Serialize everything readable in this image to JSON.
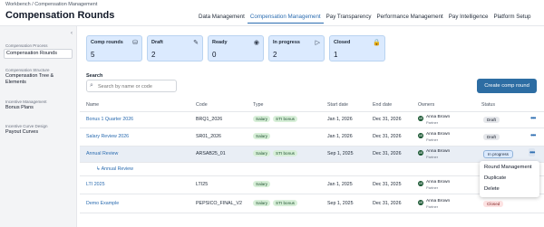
{
  "breadcrumb": "Workbench / Compensation Management",
  "page_title": "Compensation Rounds",
  "top_nav": [
    "Data Management",
    "Compensation Management",
    "Pay Transparency",
    "Performance Management",
    "Pay Intelligence",
    "Platform Setup"
  ],
  "top_nav_active": "Compensation Management",
  "sidebar": {
    "collapse_icon": "chevron-left-icon",
    "groups": [
      {
        "caption": "Compensation Process",
        "items": [
          "Compensation Rounds"
        ],
        "active": "Compensation Rounds"
      },
      {
        "caption": "Compensation Structure",
        "items": [
          "Compensation Tree &",
          "Elements"
        ]
      },
      {
        "caption": "Incentive Management",
        "items": [
          "Bonus Plans"
        ]
      },
      {
        "caption": "Incentive Curve Design",
        "items": [
          "Payout Curves"
        ]
      }
    ]
  },
  "summary_cards": [
    {
      "label": "Comp rounds",
      "value": "5",
      "icon": "coins-icon"
    },
    {
      "label": "Draft",
      "value": "2",
      "icon": "pencil-icon"
    },
    {
      "label": "Ready",
      "value": "0",
      "icon": "eye-icon"
    },
    {
      "label": "In progress",
      "value": "2",
      "icon": "play-icon"
    },
    {
      "label": "Closed",
      "value": "1",
      "icon": "lock-icon"
    }
  ],
  "search": {
    "label": "Search",
    "placeholder": "Search by name or code"
  },
  "create_button": "Create comp round",
  "table": {
    "columns": [
      "Name",
      "Code",
      "Type",
      "Start date",
      "End date",
      "Owners",
      "Status"
    ],
    "rows": [
      {
        "name": "Bonus 1 Quarter 2026",
        "code": "BRQ1_2026",
        "types": [
          "Salary",
          "STI bonus"
        ],
        "start": "Jan 1, 2026",
        "end": "Dec 31, 2026",
        "owner": "Anna Brown",
        "owner_role": "Partner",
        "status": "Draft"
      },
      {
        "name": "Salary Review 2026",
        "code": "SR01_2026",
        "types": [
          "Salary"
        ],
        "start": "Jan 1, 2026",
        "end": "Dec 31, 2026",
        "owner": "Anna Brown",
        "owner_role": "Partner",
        "status": "Draft"
      },
      {
        "name": "Annual Review",
        "code": "ARSAB25_01",
        "types": [
          "Salary",
          "STI bonus"
        ],
        "start": "Sep 1, 2025",
        "end": "Dec 31, 2026",
        "owner": "Anna Brown",
        "owner_role": "Partner",
        "status": "In progress"
      },
      {
        "name": "Annual Review",
        "sub": true
      },
      {
        "name": "LTI 2025",
        "code": "LTI25",
        "types": [
          "Salary"
        ],
        "start": "Jan 1, 2025",
        "end": "Dec 31, 2025",
        "owner": "Anna Brown",
        "owner_role": "Partner",
        "status": ""
      },
      {
        "name": "Demo Example",
        "code": "PEPSICO_FINAL_V2",
        "types": [
          "Salary",
          "STI bonus"
        ],
        "start": "Sep 1, 2025",
        "end": "Dec 31, 2026",
        "owner": "Anna Brown",
        "owner_role": "Partner",
        "status": "Closed"
      }
    ]
  },
  "context_menu": [
    "Round Management",
    "Duplicate",
    "Delete"
  ],
  "colors": {
    "accent": "#2d6da3",
    "card_bg": "#dbeafe",
    "pill_bg": "#d7efd8"
  }
}
